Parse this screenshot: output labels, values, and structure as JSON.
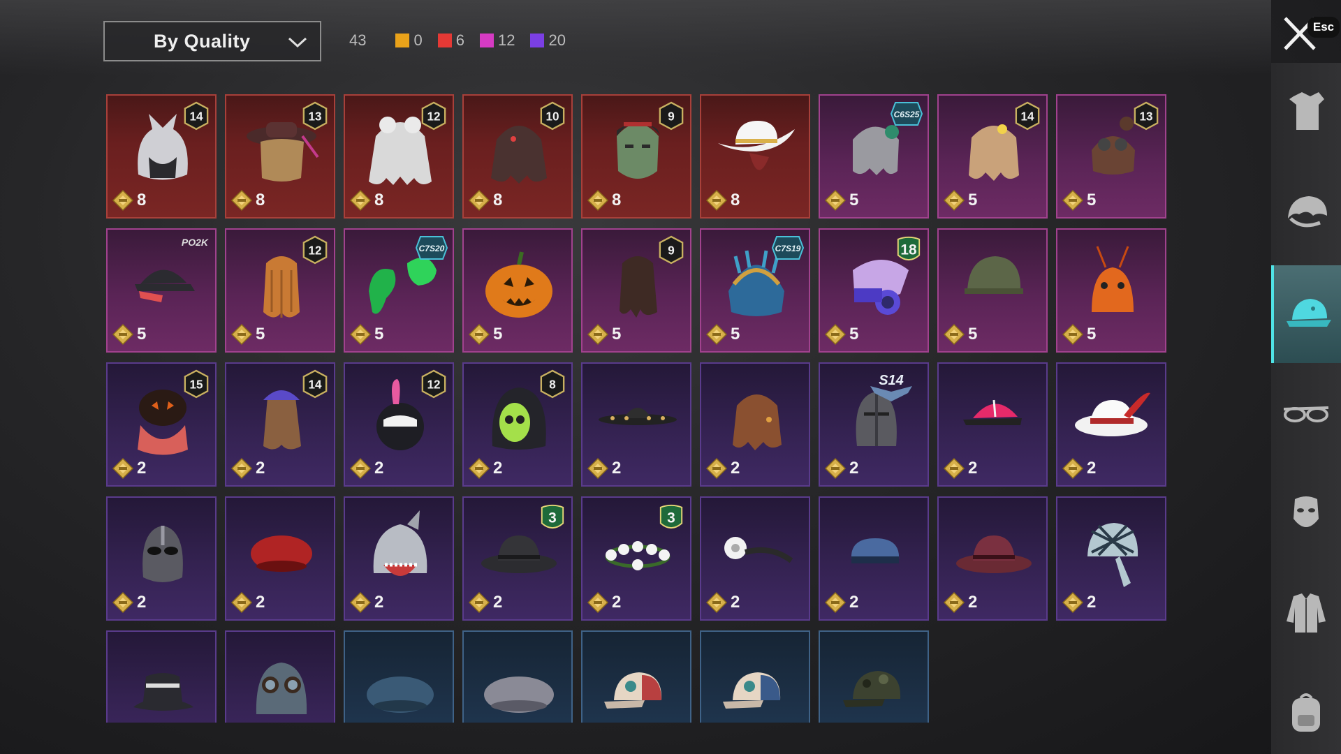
{
  "header": {
    "sort_label": "By Quality",
    "total_count": "43",
    "quality_counts": [
      {
        "value": "0",
        "color": "#e9a21a"
      },
      {
        "value": "6",
        "color": "#e53935"
      },
      {
        "value": "12",
        "color": "#d63bc3"
      },
      {
        "value": "20",
        "color": "#7b3fe4"
      }
    ]
  },
  "close": {
    "esc_label": "Esc",
    "icon": "close-icon"
  },
  "rail": [
    {
      "name": "outfit",
      "icon": "outfit-icon",
      "active": false
    },
    {
      "name": "hair",
      "icon": "hair-icon",
      "active": false
    },
    {
      "name": "hat",
      "icon": "cap-icon",
      "active": true
    },
    {
      "name": "glasses",
      "icon": "glasses-icon",
      "active": false
    },
    {
      "name": "face",
      "icon": "mask-icon",
      "active": false
    },
    {
      "name": "top",
      "icon": "jacket-icon",
      "active": false
    },
    {
      "name": "backpack",
      "icon": "backpack-icon",
      "active": false
    }
  ],
  "items": [
    {
      "quality": "red",
      "art": "wolf-hood",
      "price": "8",
      "badge": "14"
    },
    {
      "quality": "red",
      "art": "hat-hair",
      "price": "8",
      "badge": "13"
    },
    {
      "quality": "red",
      "art": "white-hair",
      "price": "8",
      "badge": "12"
    },
    {
      "quality": "red",
      "art": "dark-hair",
      "price": "8",
      "badge": "10"
    },
    {
      "quality": "red",
      "art": "zombie-head",
      "price": "8",
      "badge": "9"
    },
    {
      "quality": "red",
      "art": "cowboy-hat",
      "price": "8",
      "badge": ""
    },
    {
      "quality": "pink",
      "art": "silver-hair",
      "price": "5",
      "badge": "",
      "season": "C6S25"
    },
    {
      "quality": "pink",
      "art": "blonde-hair",
      "price": "5",
      "badge": "14"
    },
    {
      "quality": "pink",
      "art": "aviator-cap",
      "price": "5",
      "badge": "13"
    },
    {
      "quality": "pink",
      "art": "black-cap",
      "price": "5",
      "badge": "",
      "tag": "PO2K"
    },
    {
      "quality": "pink",
      "art": "braid-hair",
      "price": "5",
      "badge": "12"
    },
    {
      "quality": "pink",
      "art": "green-hair",
      "price": "5",
      "badge": "",
      "season": "C7S20"
    },
    {
      "quality": "pink",
      "art": "pumpkin",
      "price": "5",
      "badge": ""
    },
    {
      "quality": "pink",
      "art": "long-hair",
      "price": "5",
      "badge": "9"
    },
    {
      "quality": "pink",
      "art": "feather-headdress",
      "price": "5",
      "badge": "",
      "season": "C7S19"
    },
    {
      "quality": "pink",
      "art": "robot-helmet",
      "price": "5",
      "badge": "18",
      "badge_style": "green"
    },
    {
      "quality": "pink",
      "art": "army-helmet",
      "price": "5",
      "badge": ""
    },
    {
      "quality": "pink",
      "art": "shrimp-hat",
      "price": "5",
      "badge": ""
    },
    {
      "quality": "purple",
      "art": "pumpkin-hair",
      "price": "2",
      "badge": "15"
    },
    {
      "quality": "purple",
      "art": "purple-cap-hair",
      "price": "2",
      "badge": "14"
    },
    {
      "quality": "purple",
      "art": "bunny-helmet",
      "price": "2",
      "badge": "12"
    },
    {
      "quality": "purple",
      "art": "skull-hood",
      "price": "2",
      "badge": "8"
    },
    {
      "quality": "purple",
      "art": "sombrero",
      "price": "2",
      "badge": ""
    },
    {
      "quality": "purple",
      "art": "brown-hair",
      "price": "2",
      "badge": ""
    },
    {
      "quality": "purple",
      "art": "knight-helmet",
      "price": "2",
      "badge": "",
      "s14": "S14"
    },
    {
      "quality": "purple",
      "art": "pink-cap",
      "price": "2",
      "badge": ""
    },
    {
      "quality": "purple",
      "art": "white-fedora",
      "price": "2",
      "badge": ""
    },
    {
      "quality": "purple",
      "art": "luchador-mask",
      "price": "2",
      "badge": ""
    },
    {
      "quality": "purple",
      "art": "red-beret",
      "price": "2",
      "badge": ""
    },
    {
      "quality": "purple",
      "art": "shark-hood",
      "price": "2",
      "badge": ""
    },
    {
      "quality": "purple",
      "art": "black-fedora",
      "price": "2",
      "badge": "3",
      "badge_style": "green"
    },
    {
      "quality": "purple",
      "art": "flower-crown",
      "price": "2",
      "badge": "3",
      "badge_style": "green"
    },
    {
      "quality": "purple",
      "art": "head-mirror",
      "price": "2",
      "badge": ""
    },
    {
      "quality": "purple",
      "art": "police-cap",
      "price": "2",
      "badge": ""
    },
    {
      "quality": "purple",
      "art": "maroon-fedora",
      "price": "2",
      "badge": ""
    },
    {
      "quality": "purple",
      "art": "bandana-cap",
      "price": "2",
      "badge": ""
    },
    {
      "quality": "purple",
      "art": "bucket-hat",
      "price": "",
      "badge": ""
    },
    {
      "quality": "purple",
      "art": "pilot-helmet",
      "price": "",
      "badge": ""
    },
    {
      "quality": "blue",
      "art": "blue-beret",
      "price": "",
      "badge": ""
    },
    {
      "quality": "blue",
      "art": "grey-beret",
      "price": "",
      "badge": ""
    },
    {
      "quality": "blue",
      "art": "trucker-cap-red",
      "price": "",
      "badge": ""
    },
    {
      "quality": "blue",
      "art": "trucker-cap-blue",
      "price": "",
      "badge": ""
    },
    {
      "quality": "blue",
      "art": "camo-cap",
      "price": "",
      "badge": ""
    }
  ]
}
